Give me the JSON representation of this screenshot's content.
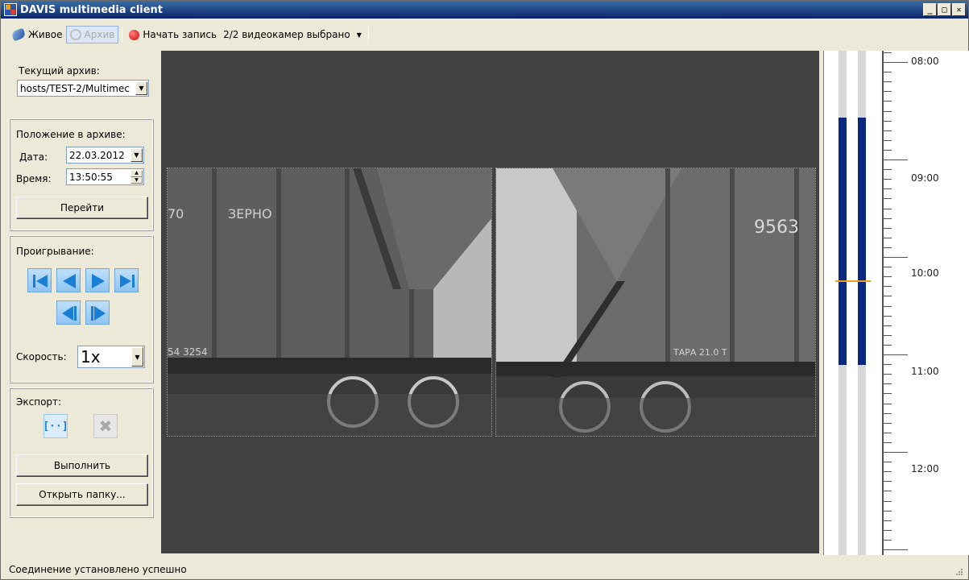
{
  "window": {
    "title": "DAVIS multimedia client"
  },
  "toolbar": {
    "live_label": "Живое",
    "archive_label": "Архив",
    "record_label": "Начать запись",
    "cameras_label": "2/2 видеокамер выбрано"
  },
  "archive": {
    "label": "Текущий архив:",
    "value": "hosts/TEST-2/Multimec"
  },
  "position": {
    "group_label": "Положение в архиве:",
    "date_label": "Дата:",
    "date_value": "22.03.2012",
    "time_label": "Время:",
    "time_value": "13:50:55",
    "go_button": "Перейти"
  },
  "playback": {
    "label": "Проигрывание:",
    "speed_label": "Скорость:",
    "speed_value": "1x"
  },
  "export": {
    "label": "Экспорт:",
    "execute_button": "Выполнить",
    "open_folder_button": "Открыть папку..."
  },
  "cameras": [
    {
      "text_top": "ЗЕРНО",
      "text_num": "70",
      "text_bottom": "54 3254"
    },
    {
      "text_top": "9563",
      "text_num": "",
      "text_bottom": "ТАРА 21.0 Т"
    }
  ],
  "timeline": {
    "labels": [
      "08:00",
      "09:00",
      "10:00",
      "11:00",
      "12:00"
    ],
    "marker_color": "#f0a020",
    "segment_color": "#0a2880"
  },
  "statusbar": {
    "text": "Соединение установлено успешно"
  }
}
